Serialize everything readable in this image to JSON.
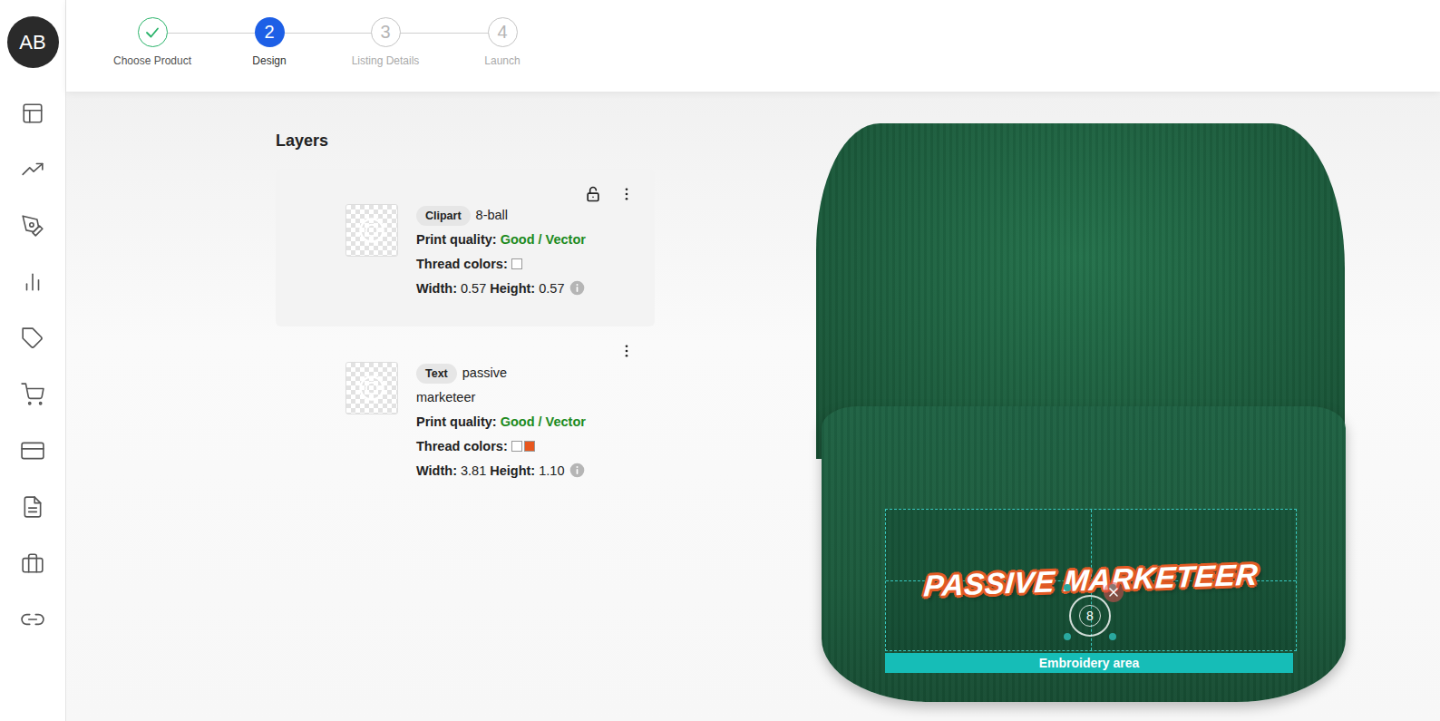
{
  "user": {
    "initials": "AB"
  },
  "steps": [
    {
      "label": "Choose Product",
      "number": "1",
      "completed": true,
      "selected": false
    },
    {
      "label": "Design",
      "number": "2",
      "completed": false,
      "selected": true
    },
    {
      "label": "Listing Details",
      "number": "3",
      "completed": false,
      "selected": false
    },
    {
      "label": "Launch",
      "number": "4",
      "completed": false,
      "selected": false
    }
  ],
  "layers": {
    "title": "Layers",
    "labels": {
      "print_quality": "Print quality:",
      "thread_colors": "Thread colors:",
      "width": "Width:",
      "height": "Height:"
    },
    "items": [
      {
        "type": "Clipart",
        "name": "8-ball",
        "selected": true,
        "locked": false,
        "print_quality": "Good / Vector",
        "thread_colors": [
          "#ffffff"
        ],
        "width": "0.57",
        "height": "0.57"
      },
      {
        "type": "Text",
        "name": "passive marketeer",
        "selected": false,
        "locked": false,
        "print_quality": "Good / Vector",
        "thread_colors": [
          "#ffffff",
          "#e8571e"
        ],
        "width": "3.81",
        "height": "1.10"
      }
    ]
  },
  "canvas": {
    "design_text": "PASSIVE MARKETEER",
    "clipart_glyph": "8",
    "area_label": "Embroidery area"
  }
}
